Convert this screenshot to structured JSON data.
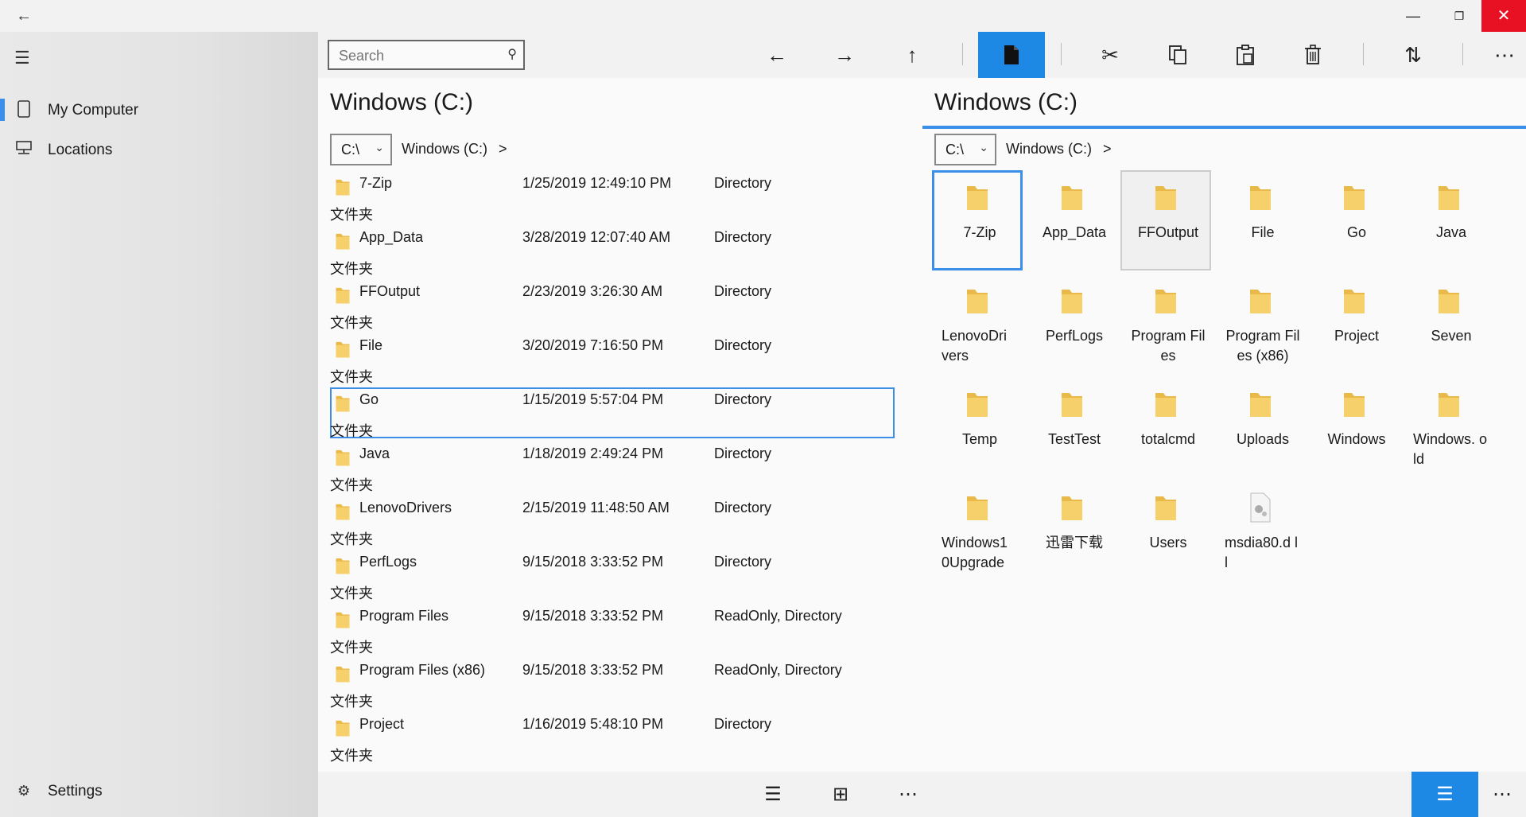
{
  "window": {
    "minimize": "—",
    "restore": "❐",
    "close": "✕"
  },
  "sidebar": {
    "items": [
      {
        "label": "My Computer"
      },
      {
        "label": "Locations"
      }
    ],
    "settings": "Settings"
  },
  "toolbar": {
    "search_placeholder": "Search"
  },
  "left_pane": {
    "title": "Windows (C:)",
    "drive": "C:\\",
    "breadcrumb": "Windows (C:)",
    "breadcrumb_sep": ">",
    "rows": [
      {
        "name": "7-Zip",
        "date": "1/25/2019 12:49:10 PM",
        "attr": "Directory",
        "kind": "文件夹"
      },
      {
        "name": "App_Data",
        "date": "3/28/2019 12:07:40 AM",
        "attr": "Directory",
        "kind": "文件夹"
      },
      {
        "name": "FFOutput",
        "date": "2/23/2019 3:26:30 AM",
        "attr": "Directory",
        "kind": "文件夹"
      },
      {
        "name": "File",
        "date": "3/20/2019 7:16:50 PM",
        "attr": "Directory",
        "kind": "文件夹"
      },
      {
        "name": "Go",
        "date": "1/15/2019 5:57:04 PM",
        "attr": "Directory",
        "kind": "文件夹"
      },
      {
        "name": "Java",
        "date": "1/18/2019 2:49:24 PM",
        "attr": "Directory",
        "kind": "文件夹"
      },
      {
        "name": "LenovoDrivers",
        "date": "2/15/2019 11:48:50 AM",
        "attr": "Directory",
        "kind": "文件夹"
      },
      {
        "name": "PerfLogs",
        "date": "9/15/2018 3:33:52 PM",
        "attr": "Directory",
        "kind": "文件夹"
      },
      {
        "name": "Program Files",
        "date": "9/15/2018 3:33:52 PM",
        "attr": "ReadOnly, Directory",
        "kind": "文件夹"
      },
      {
        "name": "Program Files (x86)",
        "date": "9/15/2018 3:33:52 PM",
        "attr": "ReadOnly, Directory",
        "kind": "文件夹"
      },
      {
        "name": "Project",
        "date": "1/16/2019 5:48:10 PM",
        "attr": "Directory",
        "kind": "文件夹"
      }
    ]
  },
  "right_pane": {
    "title": "Windows (C:)",
    "drive": "C:\\",
    "breadcrumb": "Windows (C:)",
    "breadcrumb_sep": ">",
    "tiles": [
      {
        "label": "7-Zip"
      },
      {
        "label": "App_Data"
      },
      {
        "label": "FFOutput"
      },
      {
        "label": "File"
      },
      {
        "label": "Go"
      },
      {
        "label": "Java"
      },
      {
        "label": "LenovoDri vers"
      },
      {
        "label": "PerfLogs"
      },
      {
        "label": "Program Files"
      },
      {
        "label": "Program Files (x86)"
      },
      {
        "label": "Project"
      },
      {
        "label": "Seven"
      },
      {
        "label": "Temp"
      },
      {
        "label": "TestTest"
      },
      {
        "label": "totalcmd"
      },
      {
        "label": "Uploads"
      },
      {
        "label": "Windows"
      },
      {
        "label": "Windows. old"
      },
      {
        "label": "Windows1 0Upgrade"
      },
      {
        "label": "迅雷下载"
      },
      {
        "label": "Users"
      },
      {
        "label": "msdia80.d ll"
      }
    ]
  },
  "colors": {
    "accent": "#1e88e5",
    "selection": "#3b8fe8",
    "close": "#e81123",
    "folder": "#f3c860"
  }
}
